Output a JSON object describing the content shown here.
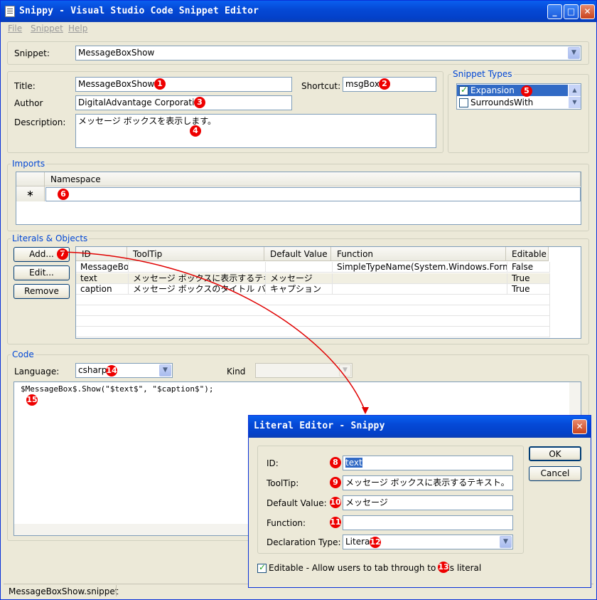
{
  "window": {
    "title": "Snippy - Visual Studio Code Snippet Editor",
    "minimize": "_",
    "maximize": "□",
    "close": "✕"
  },
  "menu": {
    "file": "File",
    "snippet": "Snippet",
    "help": "Help"
  },
  "snippet": {
    "label": "Snippet:",
    "value": "MessageBoxShow"
  },
  "header": {
    "title_label": "Title:",
    "title_value": "MessageBoxShow",
    "title_badge": "1",
    "shortcut_label": "Shortcut:",
    "shortcut_value": "msgBox",
    "shortcut_badge": "2",
    "author_label": "Author",
    "author_value": "DigitalAdvantage Corporation",
    "author_badge": "3",
    "description_label": "Description:",
    "description_value": "メッセージ ボックスを表示します。",
    "description_badge": "4"
  },
  "snippet_types": {
    "legend": "Snippet Types",
    "items": [
      {
        "label": "Expansion",
        "checked": true,
        "badge": "5"
      },
      {
        "label": "SurroundsWith",
        "checked": false
      }
    ]
  },
  "imports": {
    "legend": "Imports",
    "column": "Namespace",
    "new_row_marker": "∗",
    "badge": "6"
  },
  "literals": {
    "legend": "Literals & Objects",
    "add_label": "Add...",
    "add_badge": "7",
    "edit_label": "Edit...",
    "remove_label": "Remove",
    "columns": [
      "ID",
      "ToolTip",
      "Default Value",
      "Function",
      "Editable"
    ],
    "rows": [
      [
        "MessageBox",
        "",
        "",
        "SimpleTypeName(System.Windows.Form...",
        "False"
      ],
      [
        "text",
        "メッセージ ボックスに表示するテキスト。",
        "メッセージ",
        "",
        "True"
      ],
      [
        "caption",
        "メッセージ ボックスのタイトル バーに...",
        "キャプション",
        "",
        "True"
      ]
    ]
  },
  "code": {
    "legend": "Code",
    "language_label": "Language:",
    "language_value": "csharp",
    "language_badge": "14",
    "kind_label": "Kind",
    "kind_value": "",
    "text": "$MessageBox$.Show(\"$text$\", \"$caption$\");",
    "code_badge": "15"
  },
  "status": {
    "file": "MessageBoxShow.snippet"
  },
  "dialog": {
    "title": "Literal Editor - Snippy",
    "id_label": "ID:",
    "id_value": "text",
    "id_badge": "8",
    "tooltip_label": "ToolTip:",
    "tooltip_value": "メッセージ ボックスに表示するテキスト。",
    "tooltip_badge": "9",
    "default_label": "Default Value:",
    "default_value": "メッセージ",
    "default_badge": "10",
    "function_label": "Function:",
    "function_value": "",
    "function_badge": "11",
    "decl_label": "Declaration Type:",
    "decl_value": "Literal",
    "decl_badge": "12",
    "editable_label": "Editable - Allow users to tab through to this literal",
    "editable_badge": "13",
    "ok_label": "OK",
    "cancel_label": "Cancel",
    "close": "✕"
  },
  "colors": {
    "accent": "#0046d5",
    "badge": "#e00000",
    "arrow": "#e00000",
    "titlebar": "#0549d6",
    "selection": "#316ac5"
  }
}
